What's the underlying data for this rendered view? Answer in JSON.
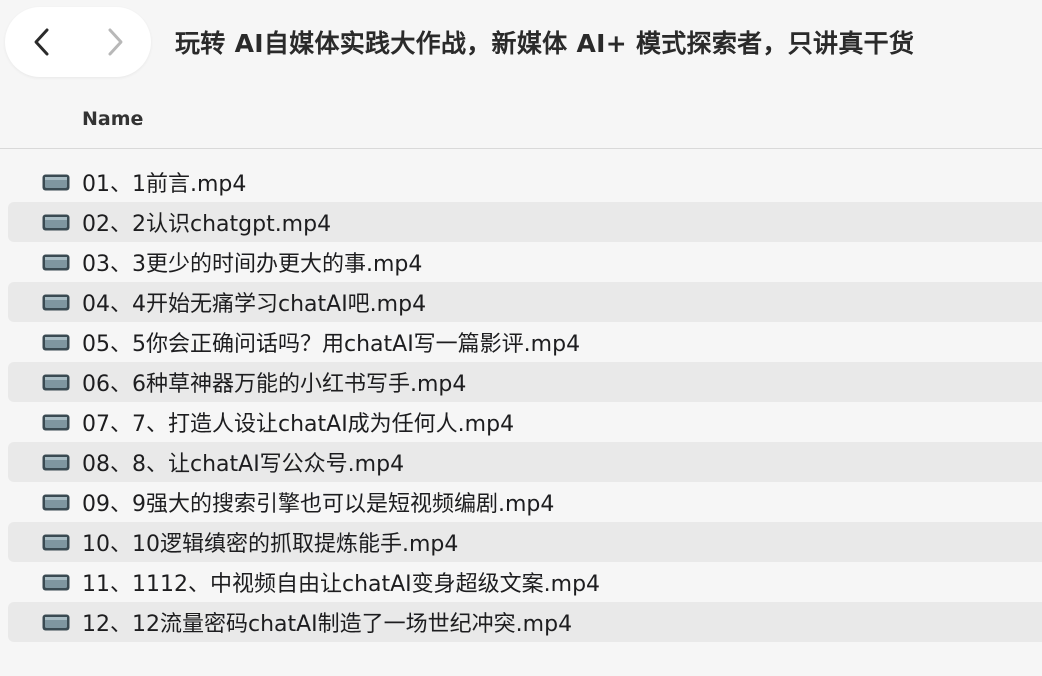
{
  "window": {
    "title": "玩转 AI自媒体实践大作战，新媒体 AI+ 模式探索者，只讲真干货"
  },
  "toolbar": {
    "back_icon": "chevron-left-icon",
    "forward_icon": "chevron-right-icon"
  },
  "columns": {
    "name": "Name"
  },
  "files": [
    {
      "name": "01、1前言.mp4"
    },
    {
      "name": "02、2认识chatgpt.mp4"
    },
    {
      "name": "03、3更少的时间办更大的事.mp4"
    },
    {
      "name": "04、4开始无痛学习chatAI吧.mp4"
    },
    {
      "name": "05、5你会正确问话吗？用chatAI写一篇影评.mp4"
    },
    {
      "name": "06、6种草神器万能的小红书写手.mp4"
    },
    {
      "name": "07、7、打造人设让chatAI成为任何人.mp4"
    },
    {
      "name": "08、8、让chatAI写公众号.mp4"
    },
    {
      "name": "09、9强大的搜索引擎也可以是短视频编剧.mp4"
    },
    {
      "name": "10、10逻辑缜密的抓取提炼能手.mp4"
    },
    {
      "name": "11、1112、中视频自由让chatAI变身超级文案.mp4"
    },
    {
      "name": "12、12流量密码chatAI制造了一场世纪冲突.mp4"
    }
  ],
  "colors": {
    "background": "#f6f6f6",
    "row_alt": "#e9e9e9",
    "icon_body": "#3a4a52",
    "icon_screen": "#7f96a0"
  }
}
